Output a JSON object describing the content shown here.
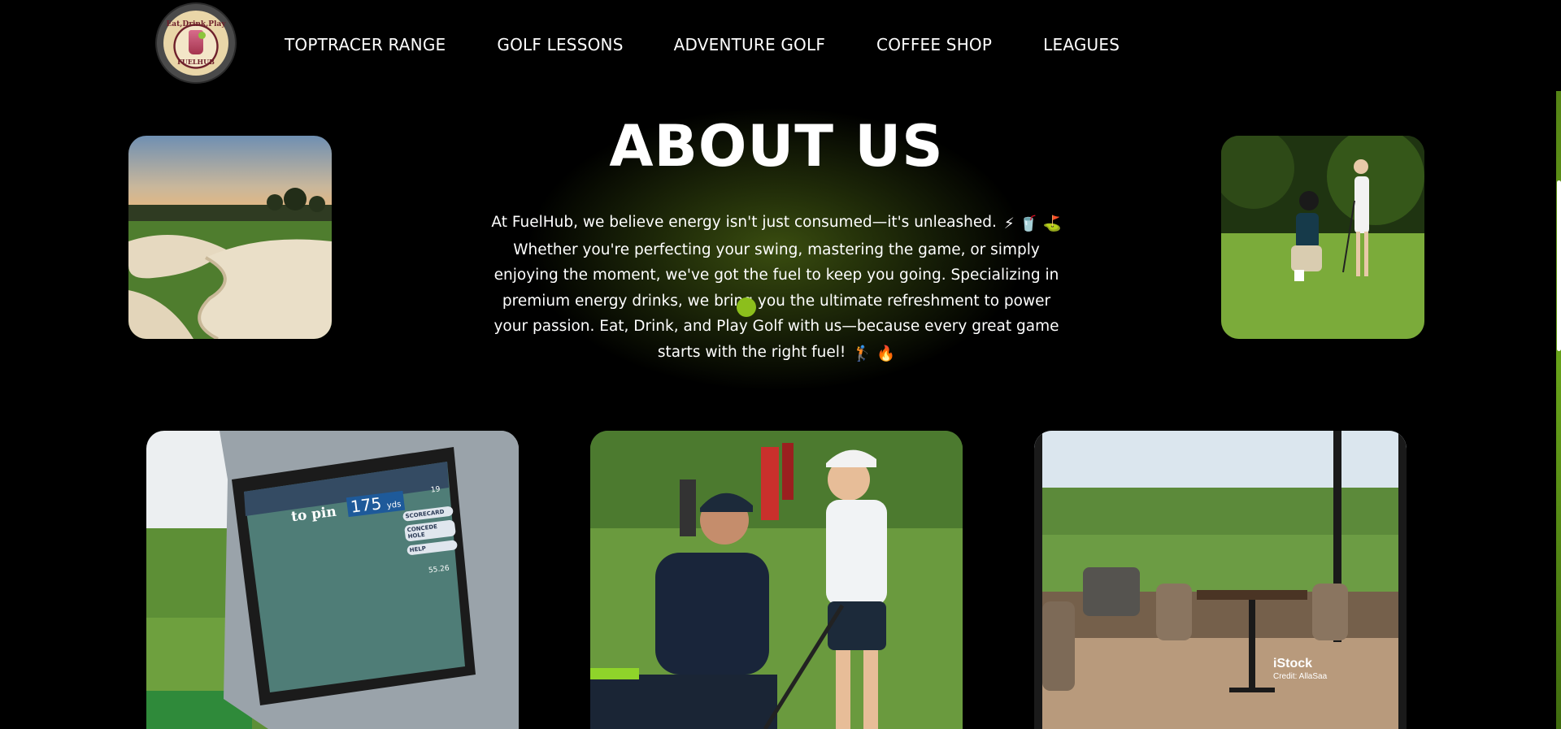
{
  "header": {
    "logo": {
      "top_text": "Eat,Drink,Play",
      "bottom_text": "FUELHUB"
    },
    "nav": [
      {
        "label": "TOPTRACER RANGE"
      },
      {
        "label": "GOLF LESSONS"
      },
      {
        "label": "ADVENTURE GOLF"
      },
      {
        "label": "COFFEE SHOP"
      },
      {
        "label": "LEAGUES"
      }
    ]
  },
  "about": {
    "title": "ABOUT US",
    "paragraph_main": "At FuelHub, we believe energy isn't just consumed—it's unleashed.",
    "emojis_1": "⚡ 🥤 ⛳",
    "paragraph_rest": "Whether you're perfecting your swing, mastering the game, or simply enjoying the moment, we've got the fuel to keep you going. Specializing in premium energy drinks, we bring you the ultimate refreshment to power your passion. Eat, Drink, and Play Golf with us—because every great game starts with the right fuel!",
    "emojis_2": "🏌 🔥"
  },
  "photos": {
    "screen": {
      "to_pin": "to pin",
      "yards": "175",
      "unit": "yds",
      "buttons": [
        "SCORECARD",
        "CONCEDE HOLE",
        "HELP"
      ],
      "hole": "19",
      "stat": "55.26"
    },
    "cafe_watermark": {
      "brand": "iStock",
      "credit": "Credit: AllaSaa"
    }
  },
  "colors": {
    "background": "#000000",
    "accent_green": "#8cbf1c",
    "glow_green": "#3a4d10",
    "text": "#ffffff"
  },
  "icons": [
    "logo-badge",
    "bolt-emoji",
    "cup-emoji",
    "golf-flag-emoji",
    "golfer-emoji",
    "fire-emoji"
  ]
}
